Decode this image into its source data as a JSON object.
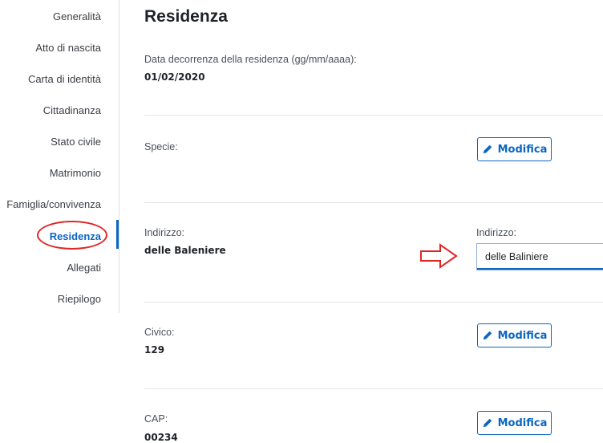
{
  "sidebar": {
    "items": [
      {
        "label": "Generalità"
      },
      {
        "label": "Atto di nascita"
      },
      {
        "label": "Carta di identità"
      },
      {
        "label": "Cittadinanza"
      },
      {
        "label": "Stato civile"
      },
      {
        "label": "Matrimonio"
      },
      {
        "label": "Famiglia/convivenza"
      },
      {
        "label": "Residenza"
      },
      {
        "label": "Allegati"
      },
      {
        "label": "Riepilogo"
      }
    ],
    "active": "Residenza"
  },
  "main": {
    "title": "Residenza",
    "decorrenza": {
      "label": "Data decorrenza della residenza (gg/mm/aaaa):",
      "value": "01/02/2020"
    },
    "specie": {
      "label": "Specie:",
      "value": "",
      "edit_label": "Modifica"
    },
    "indirizzo": {
      "label": "Indirizzo:",
      "value": "delle Baleniere",
      "edit_field_label": "Indirizzo:",
      "edit_value": "delle Baliniere"
    },
    "civico": {
      "label": "Civico:",
      "value": "129",
      "edit_label": "Modifica"
    },
    "cap": {
      "label": "CAP:",
      "value": "00234",
      "edit_label": "Modifica"
    }
  },
  "colors": {
    "accent": "#0b66c2",
    "annotation": "#e12525"
  }
}
